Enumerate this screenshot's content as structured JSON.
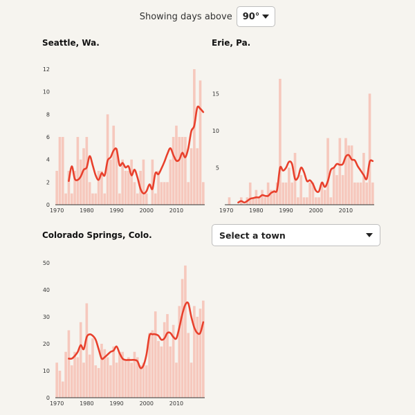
{
  "controls": {
    "label": "Showing days above",
    "threshold_value": "90°",
    "town_select_label": "Select a town"
  },
  "colors": {
    "bar": "#f6c8bd",
    "line": "#e8402c",
    "axis": "#333333",
    "background": "#f6f4ef"
  },
  "chart_data": [
    {
      "type": "bar",
      "title": "Seattle, Wa.",
      "xlabel": "",
      "ylabel": "",
      "x_ticks": [
        1970,
        1980,
        1990,
        2000,
        2010
      ],
      "y_ticks": [
        0,
        2,
        4,
        6,
        8,
        10,
        12
      ],
      "x_range": [
        1970,
        2019
      ],
      "ylim": [
        0,
        12
      ],
      "years": [
        1970,
        1971,
        1972,
        1973,
        1974,
        1975,
        1976,
        1977,
        1978,
        1979,
        1980,
        1981,
        1982,
        1983,
        1984,
        1985,
        1986,
        1987,
        1988,
        1989,
        1990,
        1991,
        1992,
        1993,
        1994,
        1995,
        1996,
        1997,
        1998,
        1999,
        2000,
        2001,
        2002,
        2003,
        2004,
        2005,
        2006,
        2007,
        2008,
        2009,
        2010,
        2011,
        2012,
        2013,
        2014,
        2015,
        2016,
        2017,
        2018,
        2019
      ],
      "values": [
        3,
        6,
        6,
        1,
        3,
        1,
        3,
        6,
        4,
        5,
        6,
        2,
        1,
        1,
        3,
        3,
        1,
        8,
        4,
        7,
        5,
        1,
        4,
        3,
        3,
        4,
        2,
        1,
        3,
        4,
        1,
        0,
        4,
        1,
        3,
        2,
        2,
        2,
        4,
        6,
        7,
        6,
        6,
        6,
        2,
        5,
        12,
        5,
        11,
        2
      ],
      "trend": [
        null,
        null,
        null,
        null,
        2.1,
        3.4,
        2.3,
        2.2,
        2.5,
        3.1,
        3.3,
        4.3,
        3.5,
        2.6,
        2.2,
        2.8,
        2.6,
        3.9,
        4.2,
        4.8,
        4.9,
        3.5,
        3.7,
        3.3,
        3.4,
        2.6,
        3.1,
        2.4,
        1.4,
        1.0,
        1.2,
        1.8,
        1.4,
        2.8,
        2.7,
        3.2,
        3.8,
        4.5,
        5.0,
        4.4,
        3.9,
        4.0,
        4.6,
        4.2,
        5.0,
        6.5,
        7.0,
        8.6,
        8.5,
        8.2
      ]
    },
    {
      "type": "bar",
      "title": "Erie, Pa.",
      "xlabel": "",
      "ylabel": "",
      "x_ticks": [
        1970,
        1980,
        1990,
        2000,
        2010
      ],
      "y_ticks": [
        5,
        10,
        15
      ],
      "x_range": [
        1970,
        2019
      ],
      "ylim": [
        0,
        18
      ],
      "years": [
        1970,
        1971,
        1972,
        1973,
        1974,
        1975,
        1976,
        1977,
        1978,
        1979,
        1980,
        1981,
        1982,
        1983,
        1984,
        1985,
        1986,
        1987,
        1988,
        1989,
        1990,
        1991,
        1992,
        1993,
        1994,
        1995,
        1996,
        1997,
        1998,
        1999,
        2000,
        2001,
        2002,
        2003,
        2004,
        2005,
        2006,
        2007,
        2008,
        2009,
        2010,
        2011,
        2012,
        2013,
        2014,
        2015,
        2016,
        2017,
        2018,
        2019
      ],
      "values": [
        0,
        1,
        0,
        0,
        0,
        1,
        0,
        1,
        3,
        1,
        2,
        1,
        2,
        1,
        3,
        2,
        2,
        3,
        17,
        3,
        3,
        5,
        3,
        7,
        1,
        4,
        1,
        1,
        3,
        3,
        1,
        1,
        3,
        2,
        9,
        1,
        5,
        4,
        9,
        4,
        9,
        8,
        8,
        3,
        3,
        3,
        7,
        3,
        15,
        3
      ],
      "trend": [
        null,
        null,
        null,
        null,
        0.3,
        0.5,
        0.3,
        0.5,
        0.8,
        0.9,
        1.0,
        1.0,
        1.3,
        1.2,
        1.2,
        1.6,
        1.8,
        2.0,
        5.0,
        4.6,
        5.0,
        5.8,
        5.5,
        3.5,
        3.7,
        5.0,
        4.4,
        3.2,
        3.3,
        2.8,
        1.9,
        1.8,
        3.0,
        2.4,
        3.2,
        4.7,
        5.0,
        5.5,
        5.4,
        5.5,
        6.5,
        6.7,
        6.1,
        6.0,
        5.2,
        4.6,
        4.0,
        3.5,
        5.8,
        5.9
      ]
    },
    {
      "type": "bar",
      "title": "Colorado Springs, Colo.",
      "xlabel": "",
      "ylabel": "",
      "x_ticks": [
        1970,
        1980,
        1990,
        2000,
        2010
      ],
      "y_ticks": [
        0,
        10,
        20,
        30,
        40,
        50
      ],
      "x_range": [
        1970,
        2019
      ],
      "ylim": [
        0,
        50
      ],
      "years": [
        1970,
        1971,
        1972,
        1973,
        1974,
        1975,
        1976,
        1977,
        1978,
        1979,
        1980,
        1981,
        1982,
        1983,
        1984,
        1985,
        1986,
        1987,
        1988,
        1989,
        1990,
        1991,
        1992,
        1993,
        1994,
        1995,
        1996,
        1997,
        1998,
        1999,
        2000,
        2001,
        2002,
        2003,
        2004,
        2005,
        2006,
        2007,
        2008,
        2009,
        2010,
        2011,
        2012,
        2013,
        2014,
        2015,
        2016,
        2017,
        2018,
        2019
      ],
      "values": [
        13,
        10,
        6,
        17,
        25,
        12,
        17,
        15,
        28,
        13,
        35,
        16,
        22,
        12,
        11,
        20,
        18,
        15,
        12,
        19,
        13,
        17,
        17,
        14,
        15,
        13,
        17,
        15,
        12,
        13,
        12,
        24,
        25,
        32,
        21,
        19,
        28,
        31,
        19,
        27,
        13,
        34,
        44,
        49,
        24,
        13,
        34,
        30,
        33,
        36
      ],
      "trend": [
        null,
        null,
        null,
        null,
        14.5,
        14.5,
        15.5,
        17.0,
        19.5,
        18.0,
        22.5,
        23.5,
        23.0,
        21.5,
        18.0,
        14.5,
        15.0,
        16.0,
        17.0,
        17.5,
        19.0,
        16.5,
        14.5,
        14.0,
        14.0,
        14.0,
        14.0,
        13.5,
        11.0,
        12.0,
        16.0,
        23.0,
        23.5,
        23.5,
        23.0,
        21.5,
        22.0,
        24.0,
        24.0,
        22.5,
        22.0,
        26.0,
        31.0,
        34.5,
        35.0,
        30.0,
        26.0,
        24.0,
        24.0,
        28.0
      ]
    }
  ]
}
